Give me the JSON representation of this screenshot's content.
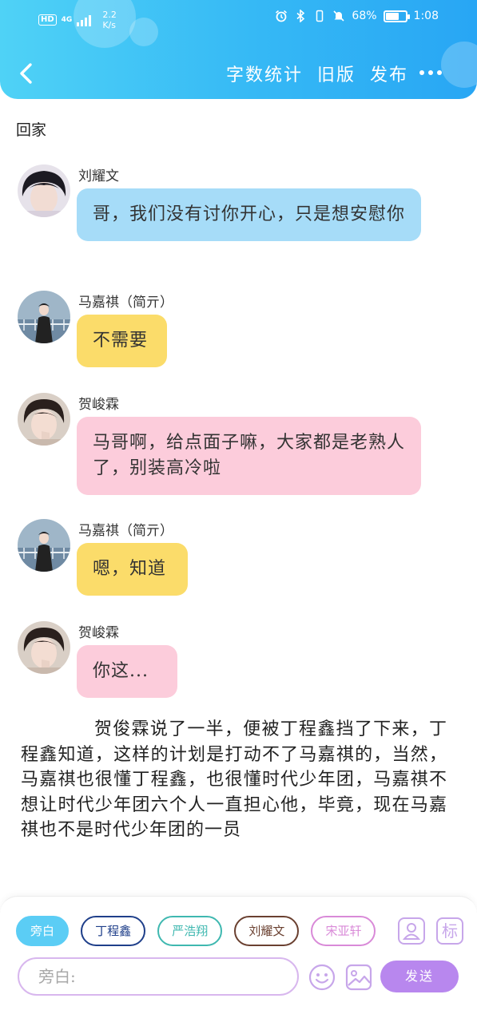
{
  "status_bar": {
    "hd_label": "HD",
    "network_label": "4G",
    "speed_value": "2.2",
    "speed_unit": "K/s",
    "battery_percent": "68%",
    "battery_level": 0.68,
    "time": "1:08"
  },
  "nav": {
    "actions": [
      "字数统计",
      "旧版",
      "发布"
    ]
  },
  "chapter_title": "回家",
  "messages": [
    {
      "sender": "刘耀文",
      "text": "哥，我们没有讨你开心，只是想安慰你",
      "color": "blue"
    },
    {
      "sender": "马嘉祺（简亓）",
      "text": "不需要",
      "color": "yellow"
    },
    {
      "sender": "贺峻霖",
      "text": "马哥啊，给点面子嘛，大家都是老熟人了，别装高冷啦",
      "color": "pink"
    },
    {
      "sender": "马嘉祺（简亓）",
      "text": "嗯，知道",
      "color": "yellow"
    },
    {
      "sender": "贺峻霖",
      "text": "你这...",
      "color": "pink"
    }
  ],
  "narration": "贺俊霖说了一半，便被丁程鑫挡了下来，丁程鑫知道，这样的计划是打动不了马嘉祺的，当然，马嘉祺也很懂丁程鑫，也很懂时代少年团，马嘉祺不想让时代少年团六个人一直担心他，毕竟，现在马嘉祺也不是时代少年团的一员",
  "roles": [
    {
      "label": "旁白",
      "color": "#5bcdf5"
    },
    {
      "label": "丁程鑫",
      "color": "#1f3f8a"
    },
    {
      "label": "严浩翔",
      "color": "#3fb8b0"
    },
    {
      "label": "刘耀文",
      "color": "#6a4030"
    },
    {
      "label": "宋亚轩",
      "color": "#d98ad8"
    }
  ],
  "tools": {
    "mark_label": "标"
  },
  "input": {
    "placeholder": "旁白:"
  },
  "send_label": "发送",
  "colors": {
    "header_start": "#4fd2f6",
    "header_end": "#28a6f4",
    "bubble_blue": "#a6dcf8",
    "bubble_yellow": "#fbdc6a",
    "bubble_pink": "#fcccdb",
    "accent_purple": "#b887ee"
  },
  "icons": [
    "back-arrow-icon",
    "more-icon",
    "alarm-icon",
    "bluetooth-icon",
    "mute-icon",
    "battery-icon",
    "person-icon",
    "emoji-icon",
    "image-icon"
  ]
}
